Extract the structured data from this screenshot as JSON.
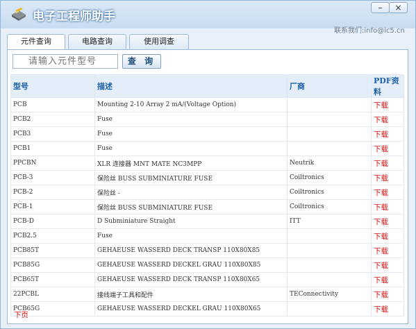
{
  "app": {
    "title": "电子工程师助手",
    "minimize_label": "–",
    "close_label": "×",
    "contact": "联系我们:info@ic5.cn"
  },
  "tabs": [
    {
      "label": "元件查询"
    },
    {
      "label": "电路查询"
    },
    {
      "label": "使用调查"
    }
  ],
  "search": {
    "placeholder": "请输入元件型号",
    "button_label": "查 询"
  },
  "table": {
    "headers": [
      "型号",
      "描述",
      "厂商",
      "PDF资料"
    ],
    "rows": [
      {
        "model": "PCB",
        "desc": "Mounting 2-10 Array 2 mA/(Voltage Option)",
        "vendor": "",
        "pdf": "下载"
      },
      {
        "model": "PCB2",
        "desc": "Fuse",
        "vendor": "",
        "pdf": "下载"
      },
      {
        "model": "PCB3",
        "desc": "Fuse",
        "vendor": "",
        "pdf": "下载"
      },
      {
        "model": "PCB1",
        "desc": "Fuse",
        "vendor": "",
        "pdf": "下载"
      },
      {
        "model": "PPCBN",
        "desc": "XLR 连接器 MNT MATE NC3MPP",
        "vendor": "Neutrik",
        "pdf": "下载"
      },
      {
        "model": "PCB-3",
        "desc": "保险丝 BUSS SUBMINIATURE FUSE",
        "vendor": "Coiltronics",
        "pdf": "下载"
      },
      {
        "model": "PCB-2",
        "desc": "保险丝 -",
        "vendor": "Coiltronics",
        "pdf": "下载"
      },
      {
        "model": "PCB-1",
        "desc": "保险丝 BUSS SUBMINIATURE FUSE",
        "vendor": "Coiltronics",
        "pdf": "下载"
      },
      {
        "model": "PCB-D",
        "desc": "D Subminiature Straight",
        "vendor": "ITT",
        "pdf": "下载"
      },
      {
        "model": "PCB2.5",
        "desc": "Fuse",
        "vendor": "",
        "pdf": "下载"
      },
      {
        "model": "PCB85T",
        "desc": "GEHAEUSE WASSERD DECK TRANSP 110X80X85",
        "vendor": "",
        "pdf": "下载"
      },
      {
        "model": "PCB85G",
        "desc": "GEHAEUSE WASSERD DECKEL GRAU 110X80X85",
        "vendor": "",
        "pdf": "下载"
      },
      {
        "model": "PCB65T",
        "desc": "GEHAEUSE WASSERD DECK TRANSP 110X80X65",
        "vendor": "",
        "pdf": "下载"
      },
      {
        "model": "22PCBL",
        "desc": "接线端子工具和配件",
        "vendor": "TEConnectivity",
        "pdf": "下载"
      },
      {
        "model": "PCB65G",
        "desc": "GEHAEUSE WASSERD DECKEL GRAU 110X80X65",
        "vendor": "",
        "pdf": "下载"
      }
    ]
  },
  "pager": {
    "next_label": "下页"
  },
  "colors": {
    "accent": "#1b5fa8",
    "link": "#dd1111",
    "frame": "#e8f1fa"
  }
}
